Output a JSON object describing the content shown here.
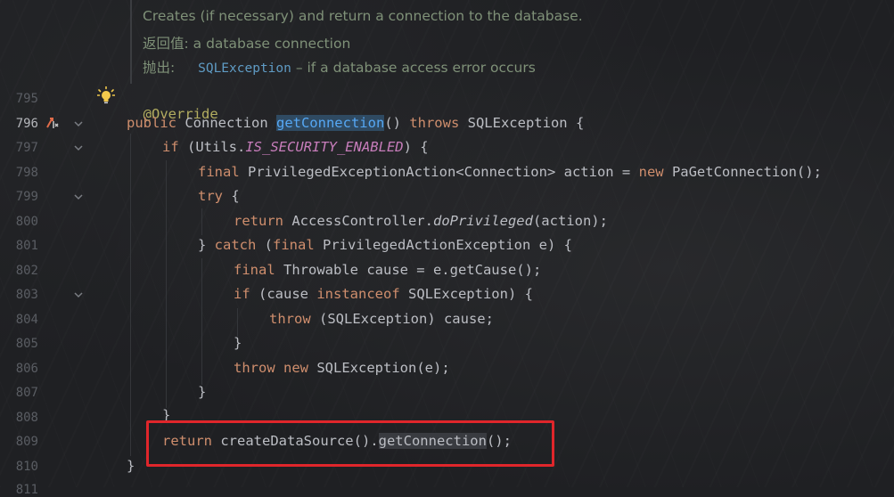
{
  "doc": {
    "line1": "Creates (if necessary) and return a connection to the database.",
    "returns_label": "返回值:",
    "returns_text": "a database connection",
    "throws_label": "抛出:",
    "throws_type": "SQLException",
    "throws_text": "– if a database access error occurs"
  },
  "gutter": {
    "lines": [
      "795",
      "796",
      "797",
      "798",
      "799",
      "800",
      "801",
      "802",
      "803",
      "804",
      "805",
      "806",
      "807",
      "808",
      "809",
      "810",
      "811"
    ]
  },
  "code": {
    "l795": "@Override",
    "l796_public": "public",
    "l796_conn": " Connection ",
    "l796_fn": "getConnection",
    "l796_paren": "() ",
    "l796_throws": "throws",
    "l796_rest": " SQLException {",
    "l797_if": "if",
    "l797_a": " (Utils.",
    "l797_static": "IS_SECURITY_ENABLED",
    "l797_b": ") {",
    "l798_final": "final",
    "l798_a": " PrivilegedExceptionAction<Connection> action = ",
    "l798_new": "new",
    "l798_b": " PaGetConnection();",
    "l799_try": "try",
    "l799_b": " {",
    "l800_return": "return",
    "l800_a": " AccessController.",
    "l800_ital": "doPrivileged",
    "l800_b": "(action);",
    "l801_a": "} ",
    "l801_catch": "catch",
    "l801_b": " (",
    "l801_final": "final",
    "l801_c": " PrivilegedActionException e) {",
    "l802_final": "final",
    "l802_a": " Throwable cause = e.getCause();",
    "l803_if": "if",
    "l803_a": " (cause ",
    "l803_instanceof": "instanceof",
    "l803_b": " SQLException) {",
    "l804_throw": "throw",
    "l804_a": " (SQLException) cause;",
    "l805": "}",
    "l806_throw": "throw",
    "l806_a": " ",
    "l806_new": "new",
    "l806_b": " SQLException(e);",
    "l807": "}",
    "l808": "}",
    "l809_return": "return",
    "l809_a": " createDataSource().",
    "l809_call": "getConnection",
    "l809_b": "();",
    "l810": "}"
  },
  "colors": {
    "keyword": "#cf8e6d",
    "function": "#56a8f5",
    "annotation": "#b3ae60",
    "static_field": "#c77dbb",
    "highlight_box": "#e0262b"
  },
  "icons": [
    "bulb-icon",
    "implements-icon",
    "fold-chevron-icon"
  ]
}
